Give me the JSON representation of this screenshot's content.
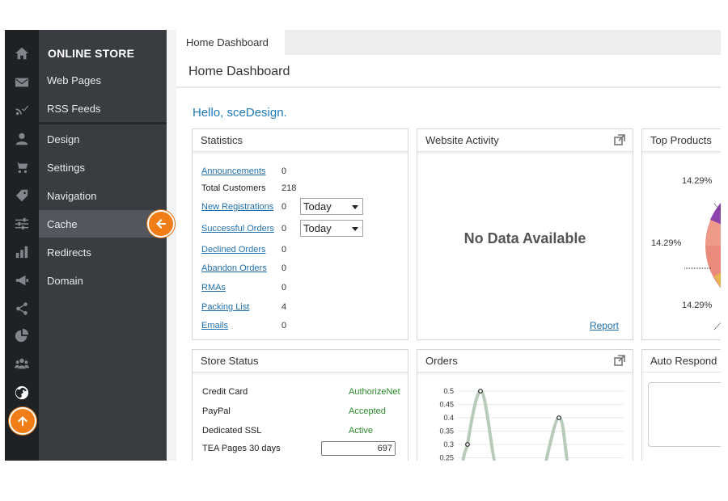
{
  "nav": {
    "title": "ONLINE STORE",
    "items": [
      {
        "label": "Web Pages",
        "active": false
      },
      {
        "label": "RSS Feeds",
        "active": false
      },
      {
        "label": "Design",
        "active": false
      },
      {
        "label": "Settings",
        "active": false
      },
      {
        "label": "Navigation",
        "active": false
      },
      {
        "label": "Cache",
        "active": true
      },
      {
        "label": "Redirects",
        "active": false
      },
      {
        "label": "Domain",
        "active": false
      }
    ]
  },
  "rail_icons": [
    "home-icon",
    "mail-icon",
    "rss-check-icon",
    "user-icon",
    "cart-icon",
    "tag-icon",
    "sliders-icon",
    "bar-chart-icon",
    "megaphone-icon",
    "share-icon",
    "pie-chart-icon",
    "users-icon",
    "globe-icon"
  ],
  "tab": {
    "label": "Home Dashboard"
  },
  "page": {
    "title": "Home Dashboard",
    "greeting": "Hello, sceDesign."
  },
  "statistics": {
    "title": "Statistics",
    "rows": [
      {
        "label": "Announcements",
        "value": "0",
        "link": true
      },
      {
        "label": "Total Customers",
        "value": "218",
        "link": false
      },
      {
        "label": "New Registrations",
        "value": "0",
        "link": true,
        "select": "Today"
      },
      {
        "label": "Successful Orders",
        "value": "0",
        "link": true,
        "select": "Today"
      },
      {
        "label": "Declined Orders",
        "value": "0",
        "link": true
      },
      {
        "label": "Abandon Orders",
        "value": "0",
        "link": true
      },
      {
        "label": "RMAs",
        "value": "0",
        "link": true
      },
      {
        "label": "Packing List",
        "value": "4",
        "link": true
      },
      {
        "label": "Emails",
        "value": "0",
        "link": true
      }
    ]
  },
  "website_activity": {
    "title": "Website Activity",
    "empty": "No Data Available",
    "report": "Report"
  },
  "top_products": {
    "title": "Top Products",
    "labels": [
      "14.29%",
      "14.29%",
      "14.29%"
    ]
  },
  "store_status": {
    "title": "Store Status",
    "rows": [
      {
        "label": "Credit Card",
        "value": "AuthorizeNet"
      },
      {
        "label": "PayPal",
        "value": "Accepted"
      },
      {
        "label": "Dedicated SSL",
        "value": "Active"
      }
    ],
    "tea_label": "TEA Pages 30 days",
    "tea_value": "697"
  },
  "orders": {
    "title": "Orders",
    "chart_data": {
      "type": "line",
      "y_ticks": [
        "0.5",
        "0.45",
        "0.4",
        "0.35",
        "0.3",
        "0.25"
      ],
      "points": [
        0.3,
        0.5,
        0.4
      ]
    }
  },
  "auto_responder": {
    "title": "Auto Respond"
  },
  "colors": {
    "accent": "#f07d16",
    "link": "#1f6fae",
    "status_green": "#2b8a2b",
    "line": "#b8cbb8"
  }
}
